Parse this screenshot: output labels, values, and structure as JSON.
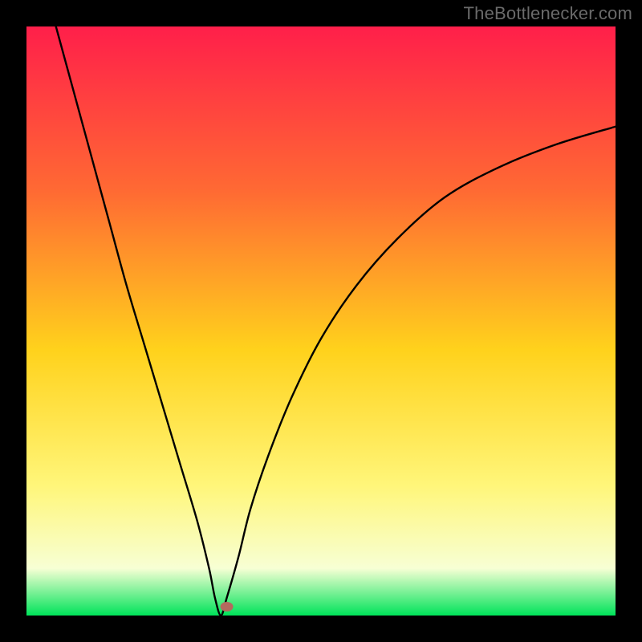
{
  "watermark": "TheBottlenecker.com",
  "chart_data": {
    "type": "line",
    "title": "",
    "xlabel": "",
    "ylabel": "",
    "xlim": [
      0,
      100
    ],
    "ylim": [
      0,
      100
    ],
    "grid": false,
    "legend": false,
    "background_gradient": [
      "#ff1f4a",
      "#ff6a33",
      "#ffd21c",
      "#fff67a",
      "#f7ffd4",
      "#00e35a"
    ],
    "curve_minimum_x": 33,
    "curve_minimum_y": 0,
    "marker": {
      "x": 34,
      "y": 1.5,
      "color": "#b4695e"
    },
    "series": [
      {
        "name": "curve",
        "x": [
          5,
          8,
          11,
          14,
          17,
          20,
          23,
          26,
          29,
          31,
          32,
          33,
          34,
          36,
          38,
          41,
          45,
          50,
          56,
          63,
          71,
          80,
          90,
          100
        ],
        "y": [
          100,
          89,
          78,
          67,
          56,
          46,
          36,
          26,
          16,
          8,
          3,
          0,
          3,
          10,
          18,
          27,
          37,
          47,
          56,
          64,
          71,
          76,
          80,
          83
        ]
      }
    ]
  }
}
